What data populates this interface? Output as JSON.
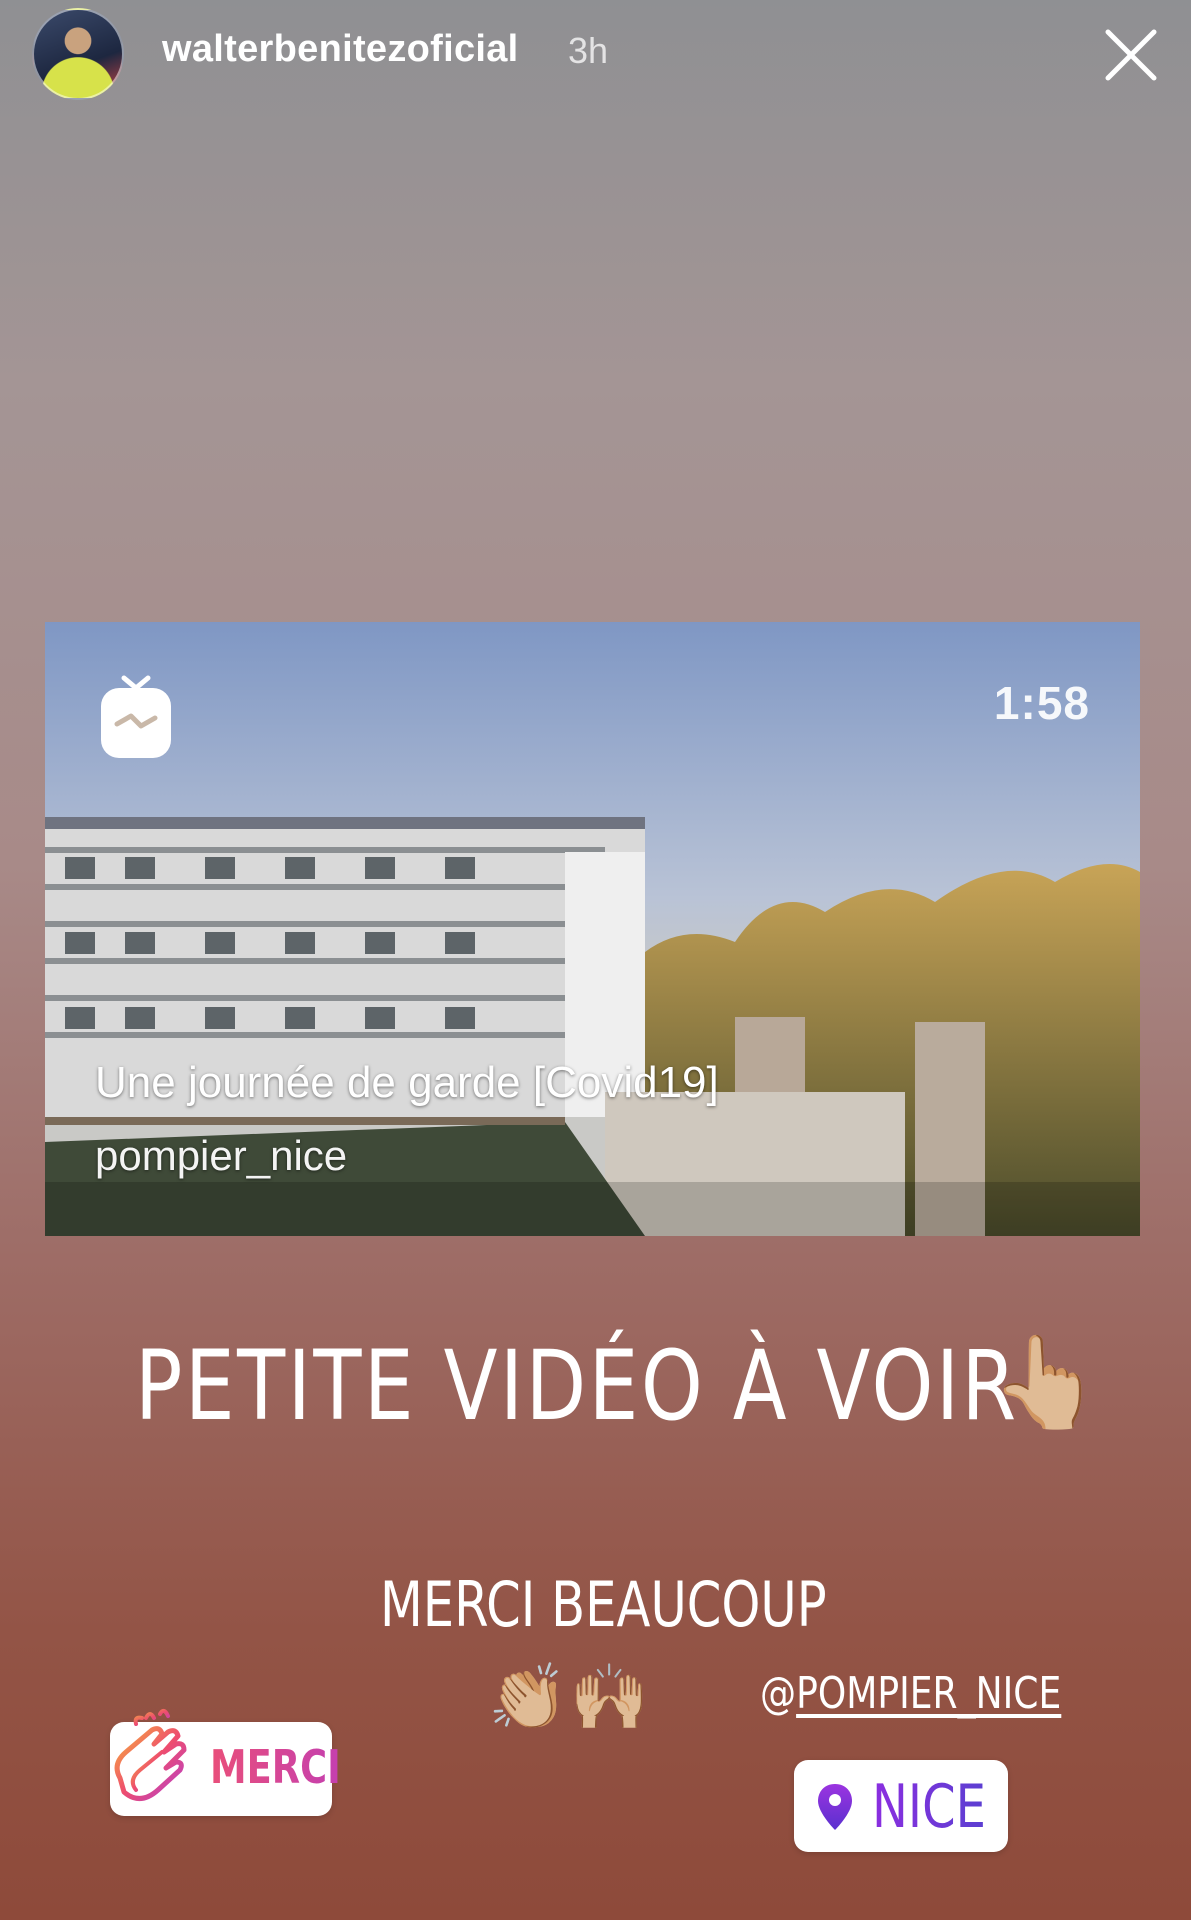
{
  "header": {
    "username": "walterbenitezoficial",
    "time_ago": "3h",
    "close_icon": "close-icon"
  },
  "video": {
    "app_icon": "igtv-icon",
    "duration": "1:58",
    "title": "Une journée de garde [Covid19]",
    "author": "pompier_nice"
  },
  "story_text": {
    "headline": "PETITE VIDÉO À VOIR",
    "headline_emoji": "👆🏼",
    "thanks": "MERCI BEAUCOUP",
    "thanks_emojis": "👏🏼🙌🏼",
    "mention_prefix": "@",
    "mention_name": "POMPIER_NICE"
  },
  "stickers": {
    "merci_label": "MERCI",
    "merci_icon": "clapping-hands-icon",
    "location_label": "NICE",
    "location_icon": "location-pin-icon"
  },
  "colors": {
    "merci_pink": "#e94f7a",
    "location_purple": "#7b2fd6"
  }
}
